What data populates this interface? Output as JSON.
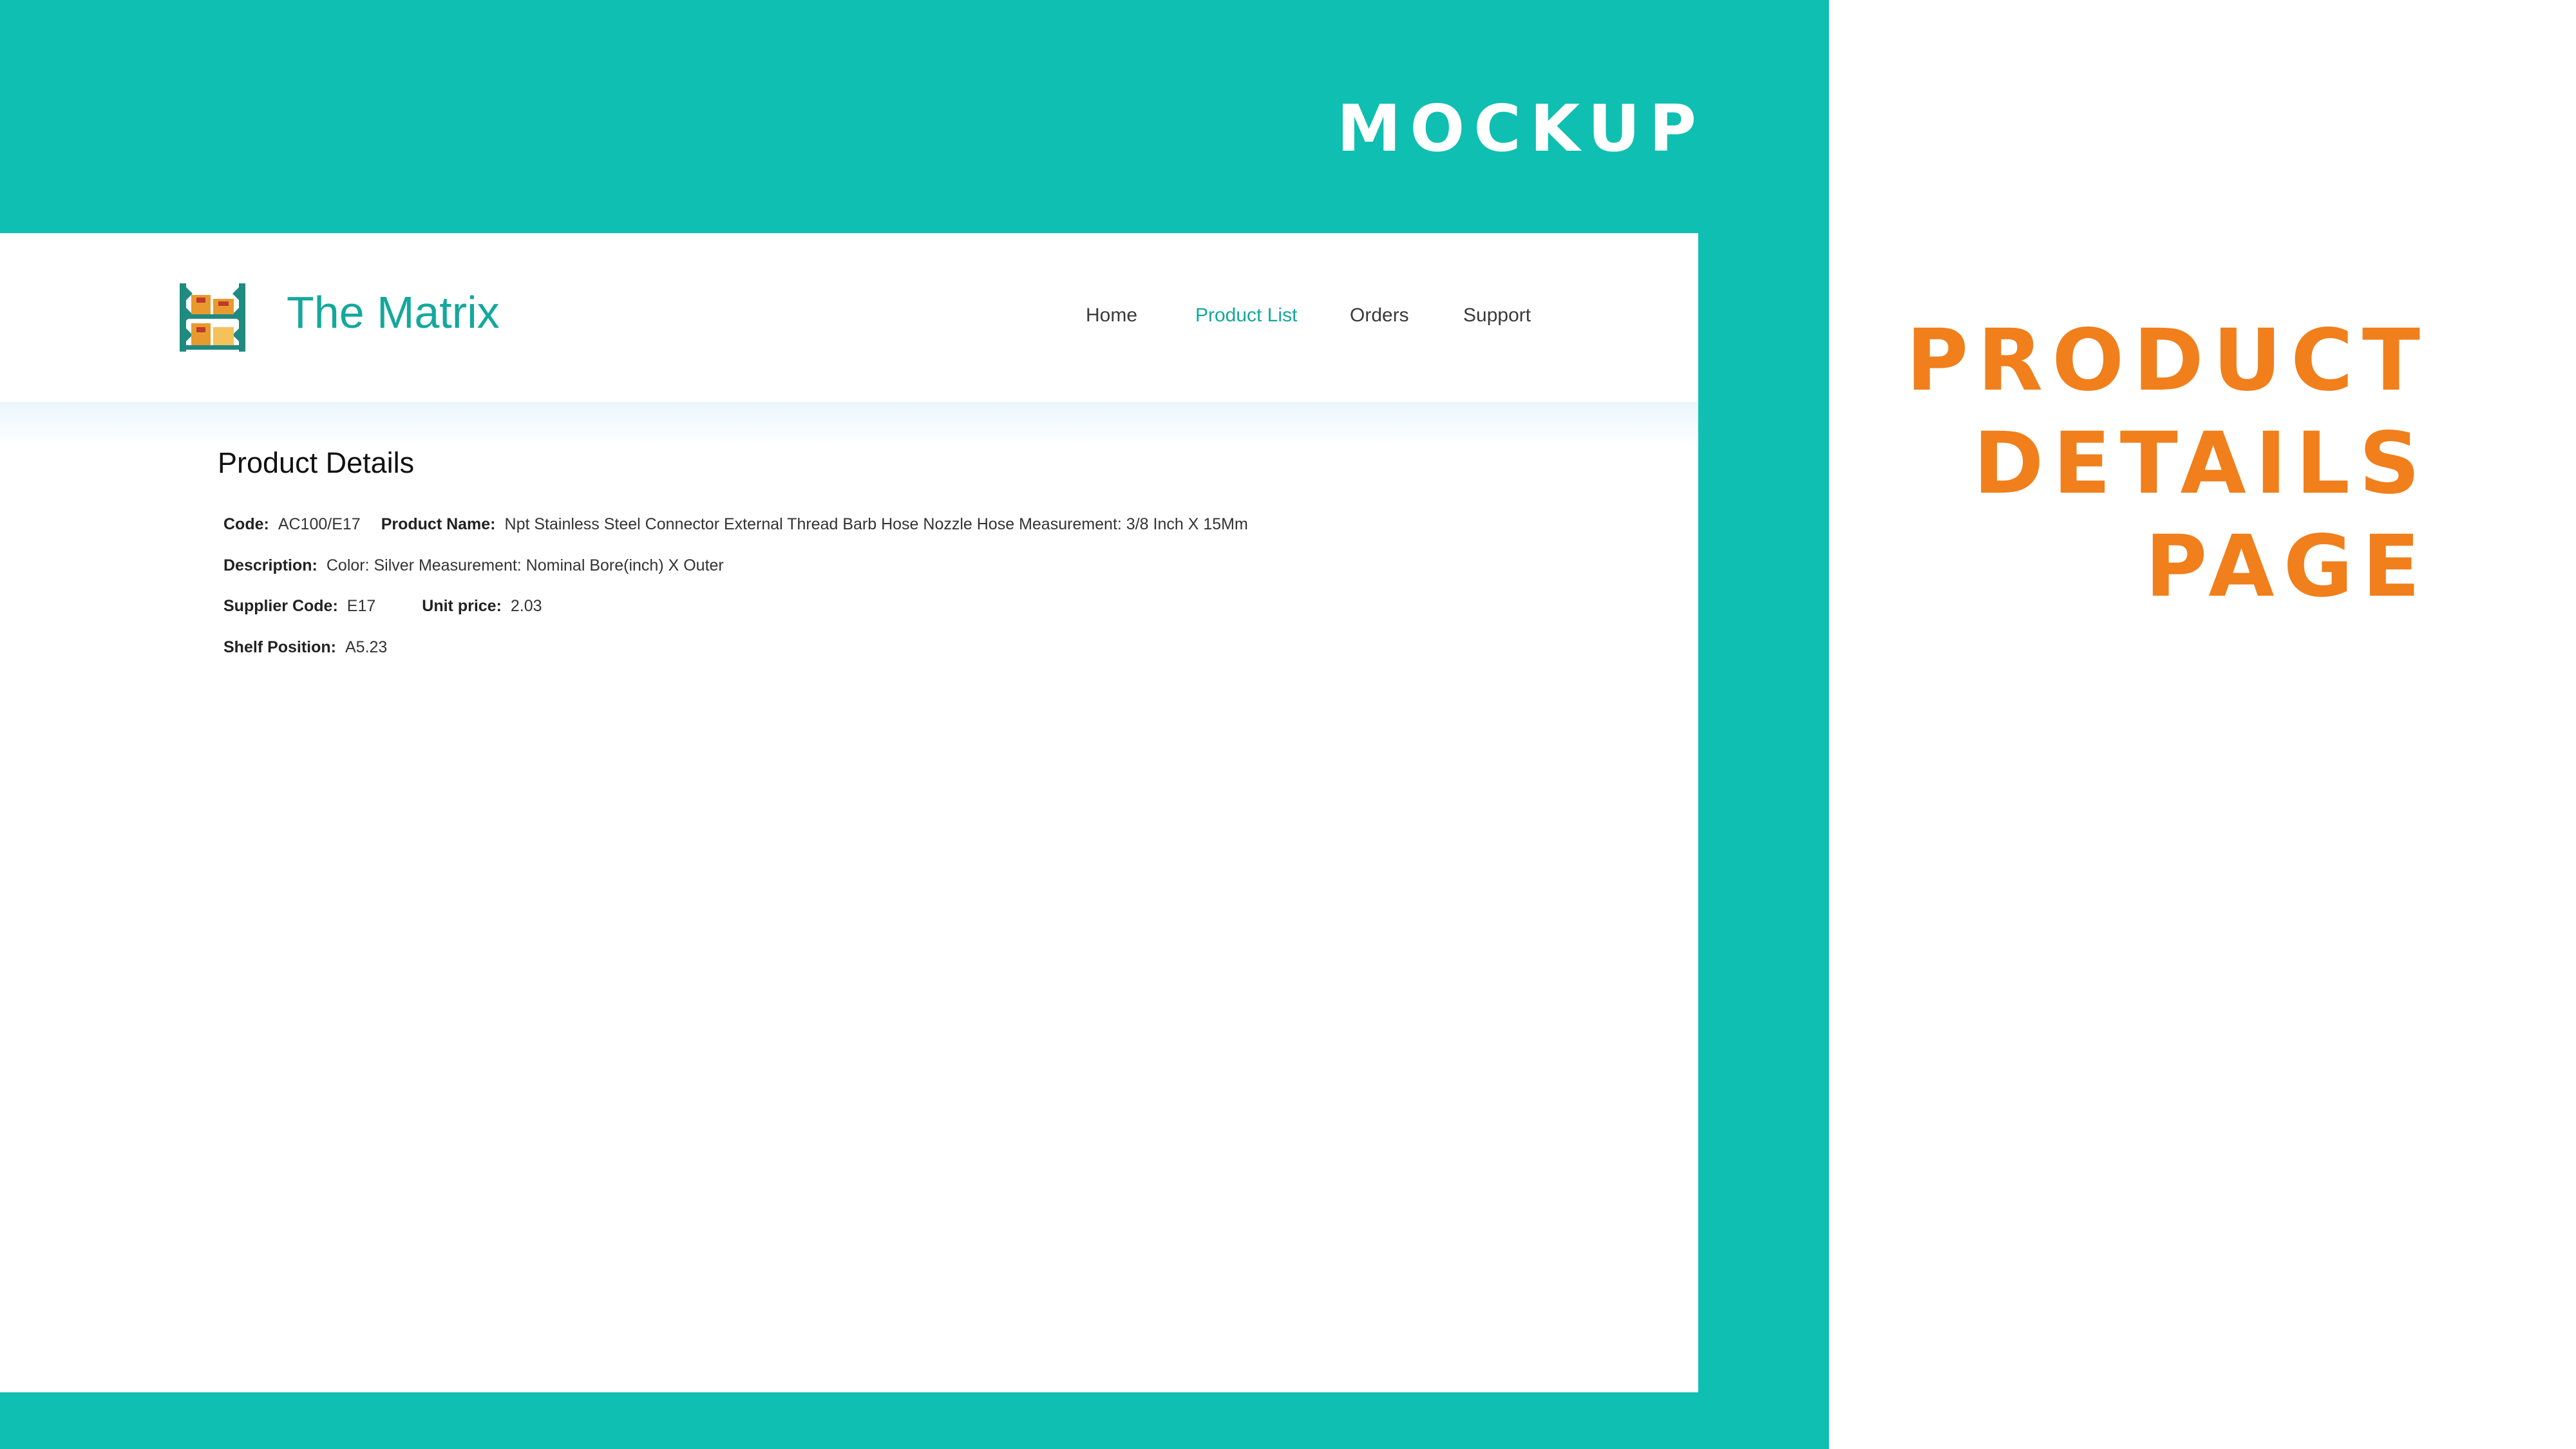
{
  "slide": {
    "heading": "MOCKUP",
    "side_title": [
      "PRODUCT",
      "DETAILS",
      "PAGE"
    ]
  },
  "app": {
    "brand": "The Matrix",
    "logo_icon": "warehouse-shelf-icon",
    "nav": [
      {
        "label": "Home",
        "active": false
      },
      {
        "label": "Product List",
        "active": true
      },
      {
        "label": "Orders",
        "active": false
      },
      {
        "label": "Support",
        "active": false
      }
    ]
  },
  "details": {
    "title": "Product Details",
    "code_label": "Code:",
    "code": "AC100/E17",
    "name_label": "Product Name:",
    "name": "Npt Stainless Steel Connector External Thread Barb Hose Nozzle Hose Measurement: 3/8 Inch X 15Mm",
    "description_label": "Description:",
    "description": "Color: Silver Measurement: Nominal Bore(inch) X Outer",
    "supplier_code_label": "Supplier Code:",
    "supplier_code": "E17",
    "unit_price_label": "Unit price:",
    "unit_price": "2.03",
    "shelf_position_label": "Shelf Position:",
    "shelf_position": "A5.23"
  },
  "colors": {
    "teal": "#0fbfb1",
    "brand_teal": "#14a89c",
    "orange": "#f07f1c"
  }
}
